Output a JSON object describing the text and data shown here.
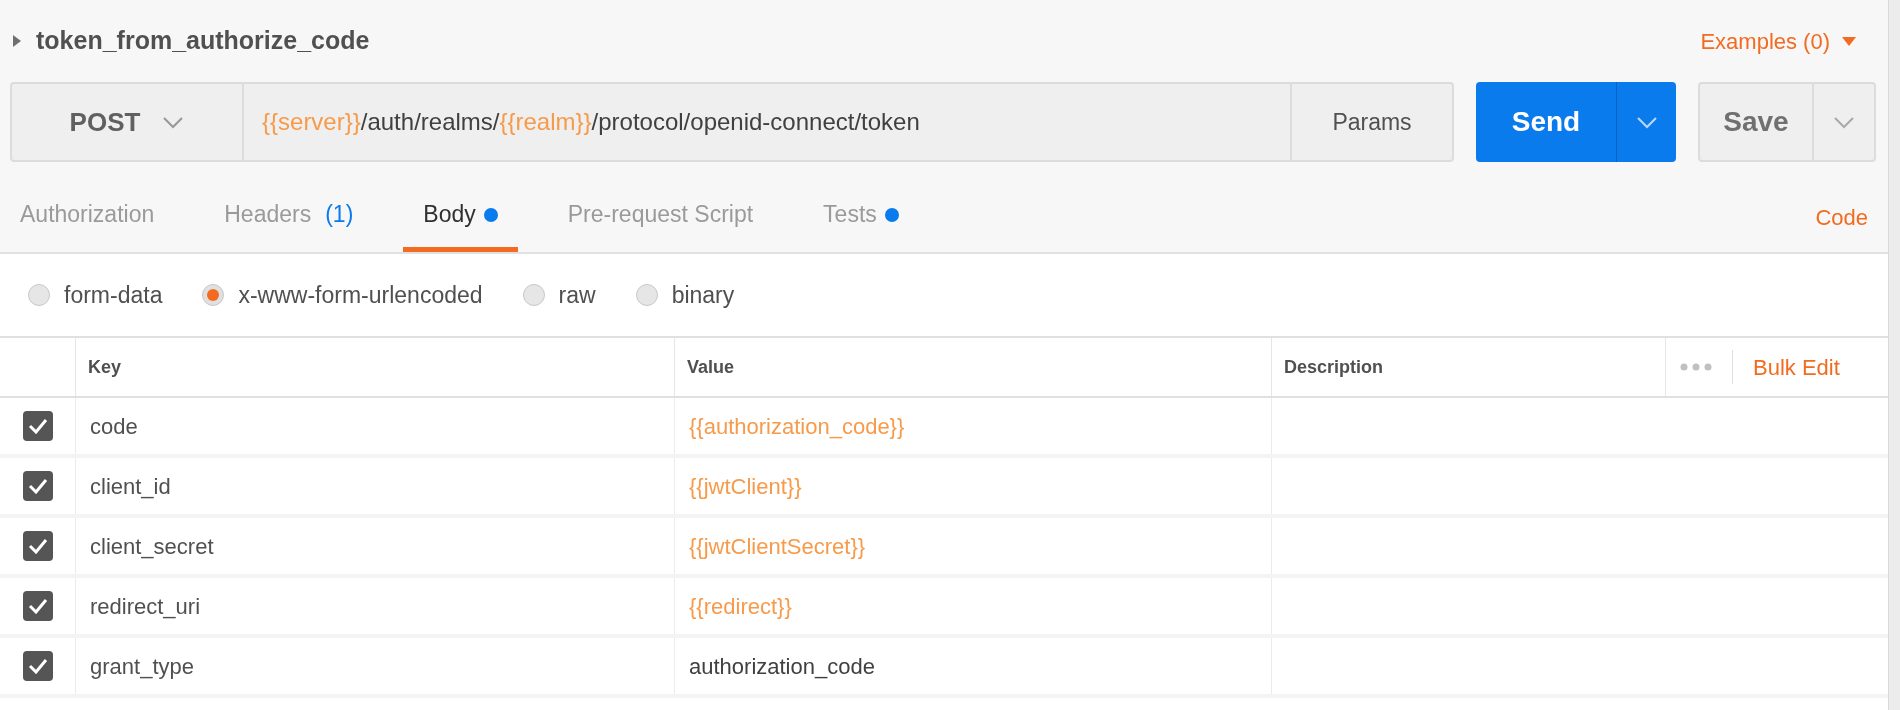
{
  "request": {
    "name": "token_from_authorize_code",
    "examples": "Examples (0)"
  },
  "url_bar": {
    "method": "POST",
    "url": [
      {
        "text": "{{server}}",
        "kind": "variable"
      },
      {
        "text": "/auth/realms/",
        "kind": "text"
      },
      {
        "text": "{{realm}}",
        "kind": "variable"
      },
      {
        "text": "/protocol/openid-connect/token",
        "kind": "text"
      }
    ],
    "params": "Params",
    "send": "Send",
    "save": "Save"
  },
  "tabs": [
    {
      "label": "Authorization",
      "selected": false,
      "dot": false
    },
    {
      "label": "Headers",
      "count": "(1)",
      "selected": false,
      "dot": false
    },
    {
      "label": "Body",
      "selected": true,
      "dot": true
    },
    {
      "label": "Pre-request Script",
      "selected": false,
      "dot": false
    },
    {
      "label": "Tests",
      "selected": false,
      "dot": true
    }
  ],
  "code_link": "Code",
  "body_types": [
    {
      "label": "form-data",
      "selected": false
    },
    {
      "label": "x-www-form-urlencoded",
      "selected": true
    },
    {
      "label": "raw",
      "selected": false
    },
    {
      "label": "binary",
      "selected": false
    }
  ],
  "table": {
    "columns": [
      "Key",
      "Value",
      "Description"
    ],
    "bulk_edit": "Bulk Edit",
    "rows": [
      {
        "checked": true,
        "key": "code",
        "value": "{{authorization_code}}",
        "variable": true
      },
      {
        "checked": true,
        "key": "client_id",
        "value": "{{jwtClient}}",
        "variable": true
      },
      {
        "checked": true,
        "key": "client_secret",
        "value": "{{jwtClientSecret}}",
        "variable": true
      },
      {
        "checked": true,
        "key": "redirect_uri",
        "value": "{{redirect}}",
        "variable": true
      },
      {
        "checked": true,
        "key": "grant_type",
        "value": "authorization_code",
        "variable": false
      }
    ]
  }
}
